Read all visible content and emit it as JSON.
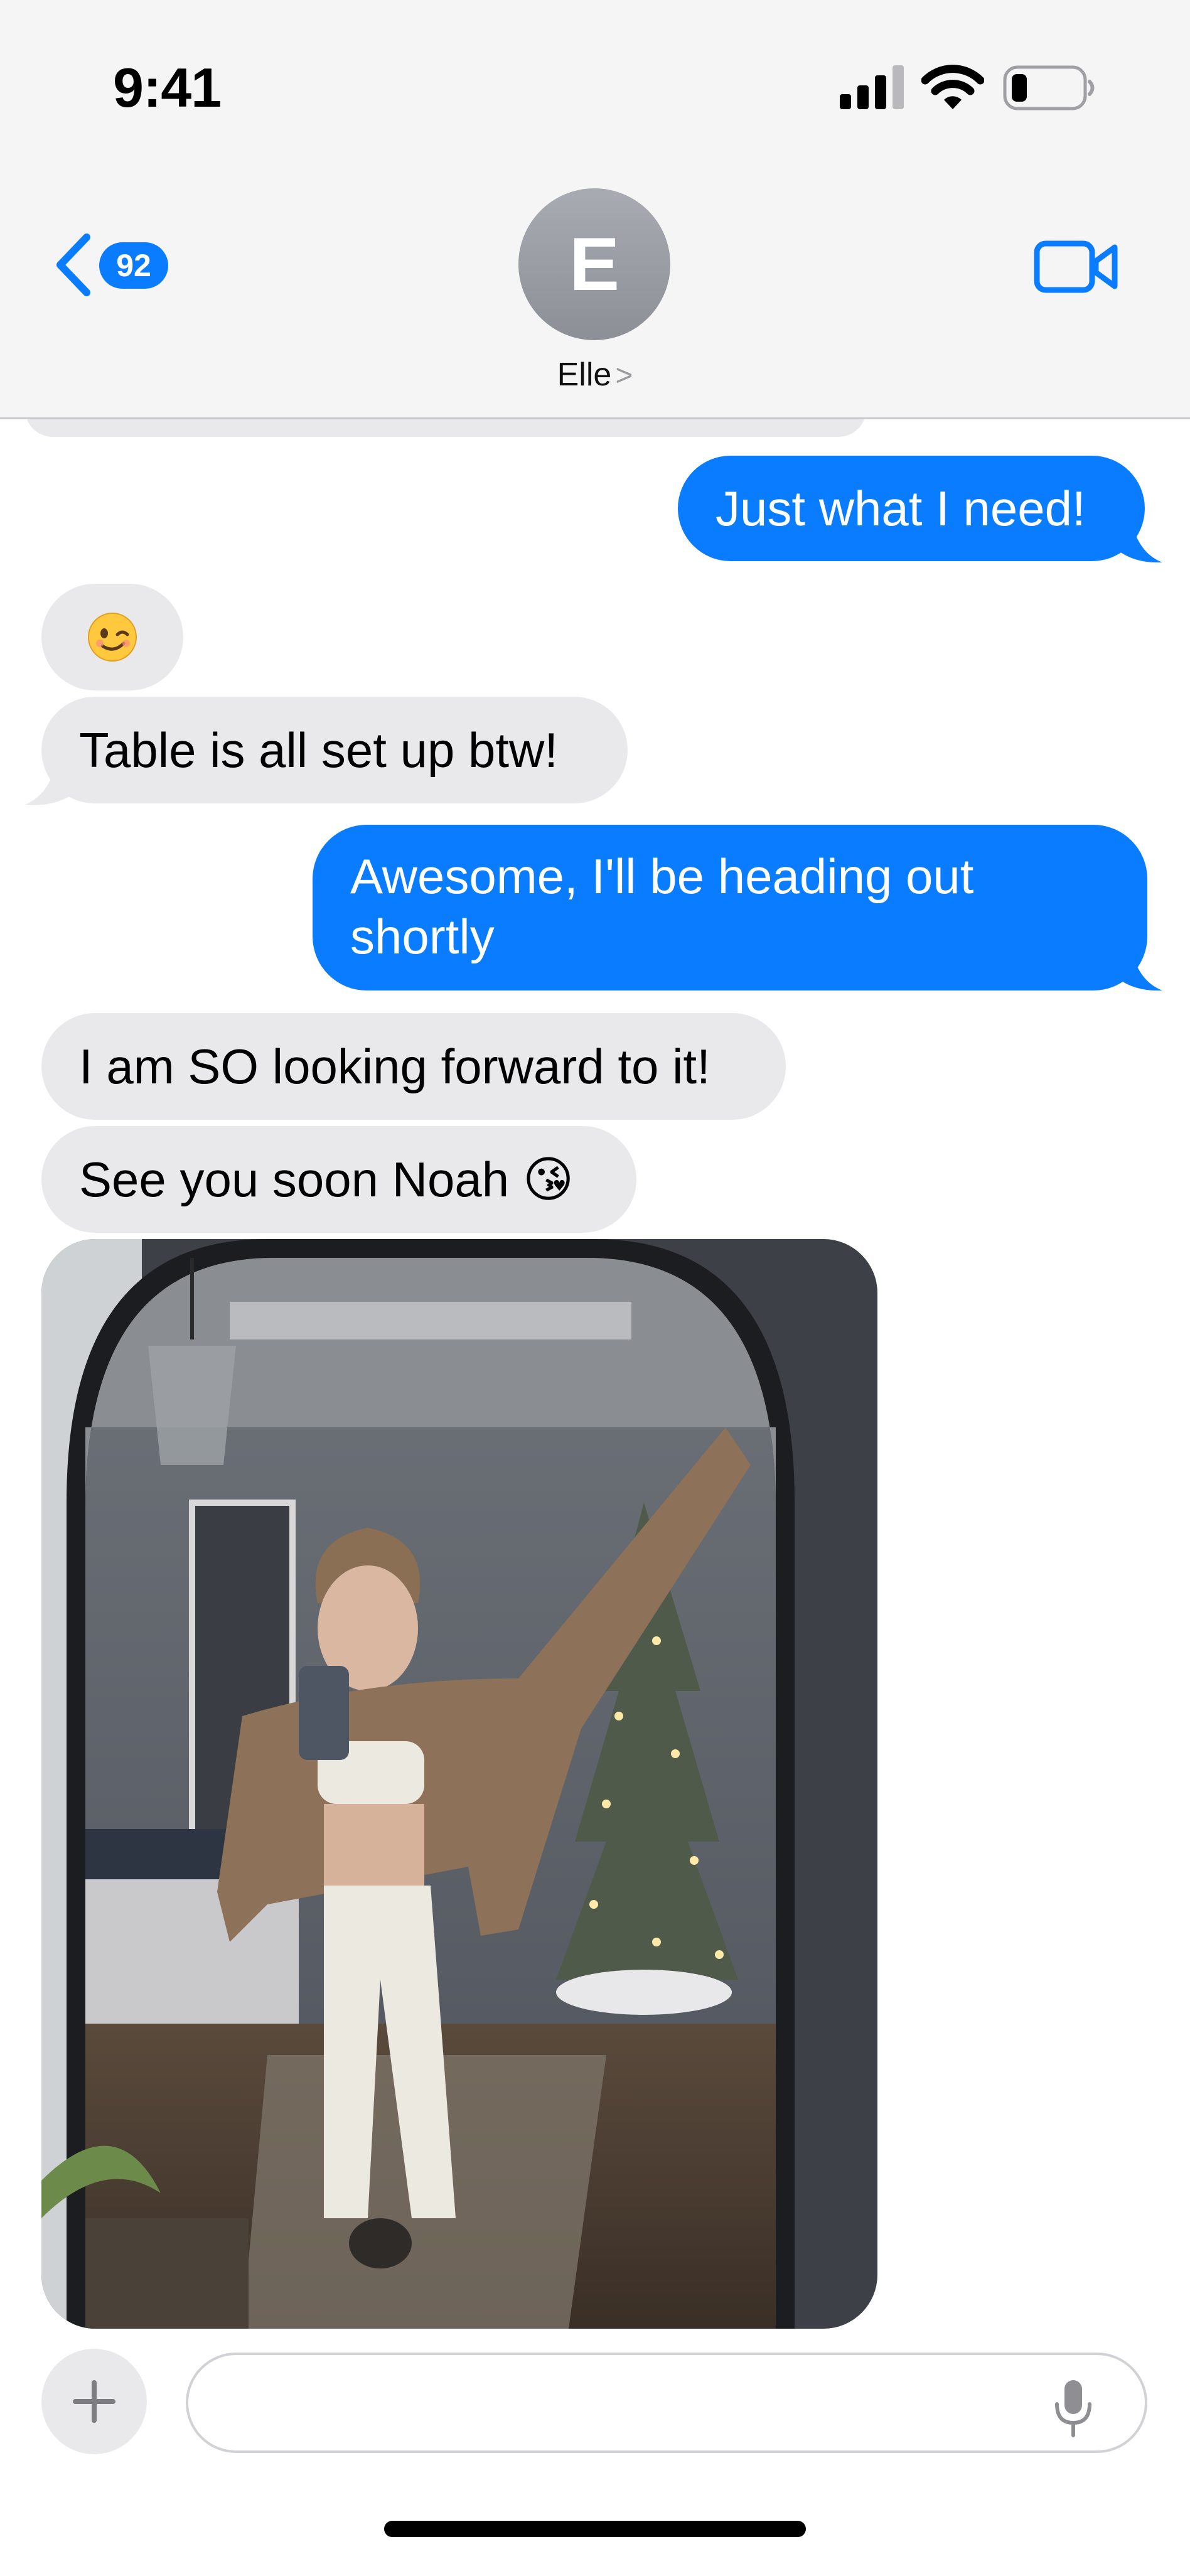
{
  "status_bar": {
    "time": "9:41",
    "icons": [
      "signal-icon",
      "wifi-icon",
      "battery-icon"
    ]
  },
  "header": {
    "back_badge": "92",
    "avatar_initial": "E",
    "contact_name": "Elle",
    "name_chevron": ">",
    "icons": [
      "back-chevron-icon",
      "video-call-icon"
    ]
  },
  "messages": [
    {
      "direction": "outgoing",
      "text": "Just what I need!"
    },
    {
      "direction": "incoming",
      "text": "😉"
    },
    {
      "direction": "incoming",
      "text": "Table is all set up btw!"
    },
    {
      "direction": "outgoing",
      "text": "Awesome, I'll be heading out shortly"
    },
    {
      "direction": "incoming",
      "text": "I am SO looking forward to it!"
    },
    {
      "direction": "incoming",
      "text": "See you soon Noah 😘"
    },
    {
      "direction": "incoming",
      "type": "photo"
    }
  ],
  "composer": {
    "placeholder": "",
    "icons": [
      "plus-icon",
      "microphone-icon"
    ]
  },
  "colors": {
    "outgoing_bubble": "#0a7cff",
    "incoming_bubble": "#e9e9eb",
    "header_background": "#f5f5f5",
    "accent": "#0a7cff"
  }
}
